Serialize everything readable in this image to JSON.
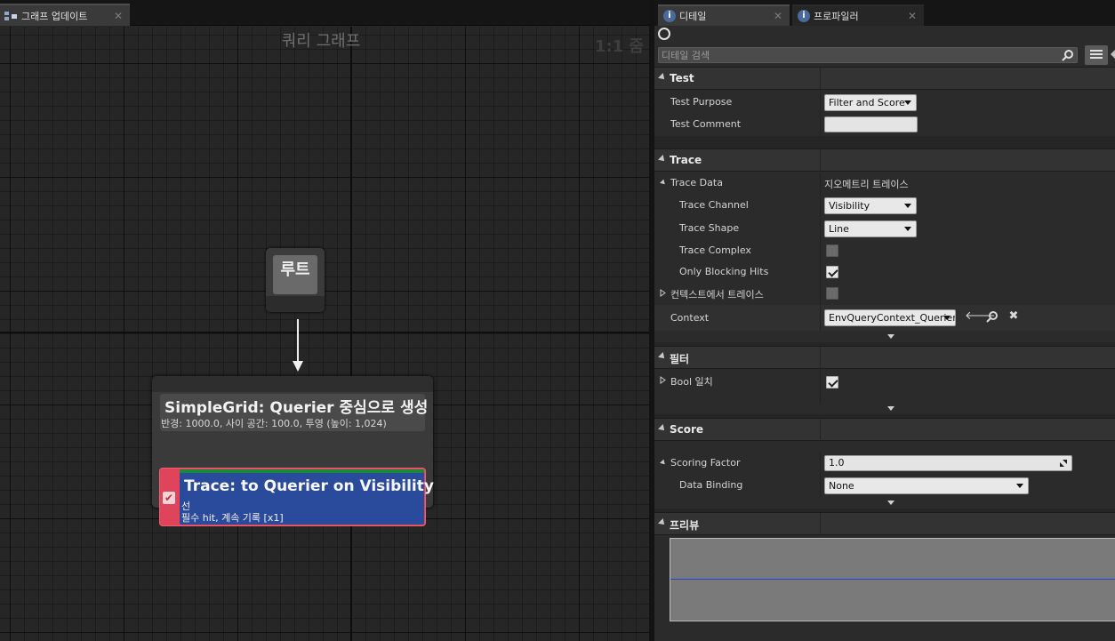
{
  "graph_tab": {
    "label": "그래프 업데이트"
  },
  "graph": {
    "title": "쿼리 그래프",
    "zoom": "1:1 줌",
    "root_node": {
      "label": "루트"
    },
    "generator_node": {
      "title": "SimpleGrid: Querier 중심으로 생성",
      "subtitle": "반경: 1000.0, 사이 공간: 100.0, 투영 (높이: 1,024)",
      "test": {
        "title": "Trace: to Querier on Visibility",
        "line1": "선",
        "line2": "필수 hit, 계속 기록 [x1]"
      }
    }
  },
  "details_tabs": [
    {
      "label": "디테일",
      "icon": "info-icon"
    },
    {
      "label": "프로파일러",
      "icon": "info-icon"
    }
  ],
  "search": {
    "placeholder": "디테일 검색"
  },
  "categories": {
    "test": "Test",
    "trace": "Trace",
    "filter": "필터",
    "score": "Score",
    "preview": "프리뷰"
  },
  "rows": {
    "test_purpose": {
      "label": "Test Purpose",
      "value": "Filter and Score"
    },
    "test_comment": {
      "label": "Test Comment",
      "value": ""
    },
    "trace_data": {
      "label": "Trace Data",
      "value": "지오메트리 트레이스"
    },
    "trace_channel": {
      "label": "Trace Channel",
      "value": "Visibility"
    },
    "trace_shape": {
      "label": "Trace Shape",
      "value": "Line"
    },
    "trace_complex": {
      "label": "Trace Complex",
      "checked": false
    },
    "only_blocking_hits": {
      "label": "Only Blocking Hits",
      "checked": true
    },
    "trace_from_context": {
      "label": "컨텍스트에서 트레이스",
      "checked": false
    },
    "context": {
      "label": "Context",
      "value": "EnvQueryContext_Querier"
    },
    "bool_match": {
      "label": "Bool 일치",
      "checked": true
    },
    "scoring_factor": {
      "label": "Scoring Factor",
      "value": "1.0"
    },
    "data_binding": {
      "label": "Data Binding",
      "value": "None"
    }
  },
  "colors": {
    "test_node_border": "#e0445a",
    "test_node_fill": "#2a4a9c",
    "test_node_bar": "#1a8a3a",
    "preview_line": "#2d3fd0"
  }
}
